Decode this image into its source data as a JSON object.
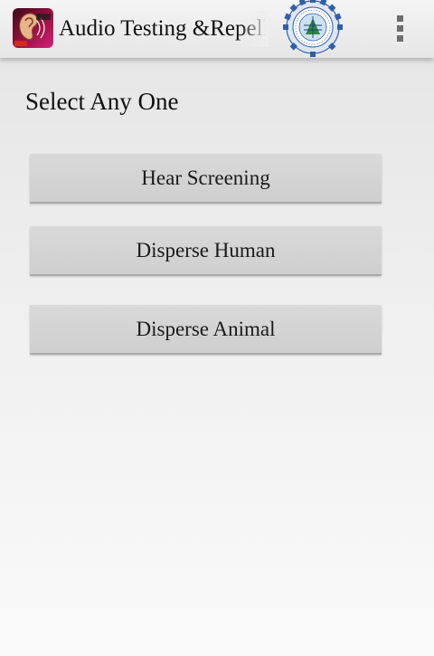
{
  "action_bar": {
    "title": "Audio Testing &Repell",
    "app_icon": "ear-app-icon",
    "seal_icon": "institution-seal-icon",
    "menu_icon": "overflow-menu-icon"
  },
  "main": {
    "prompt": "Select Any One",
    "buttons": [
      {
        "label": "Hear Screening"
      },
      {
        "label": "Disperse Human"
      },
      {
        "label": "Disperse Animal"
      }
    ]
  },
  "colors": {
    "button_bg": "#d4d4d4",
    "action_bar_bg": "#eeeeee",
    "icon_magenta": "#c0186e",
    "icon_red": "#d12a1e",
    "seal_blue": "#2f5fa8"
  }
}
